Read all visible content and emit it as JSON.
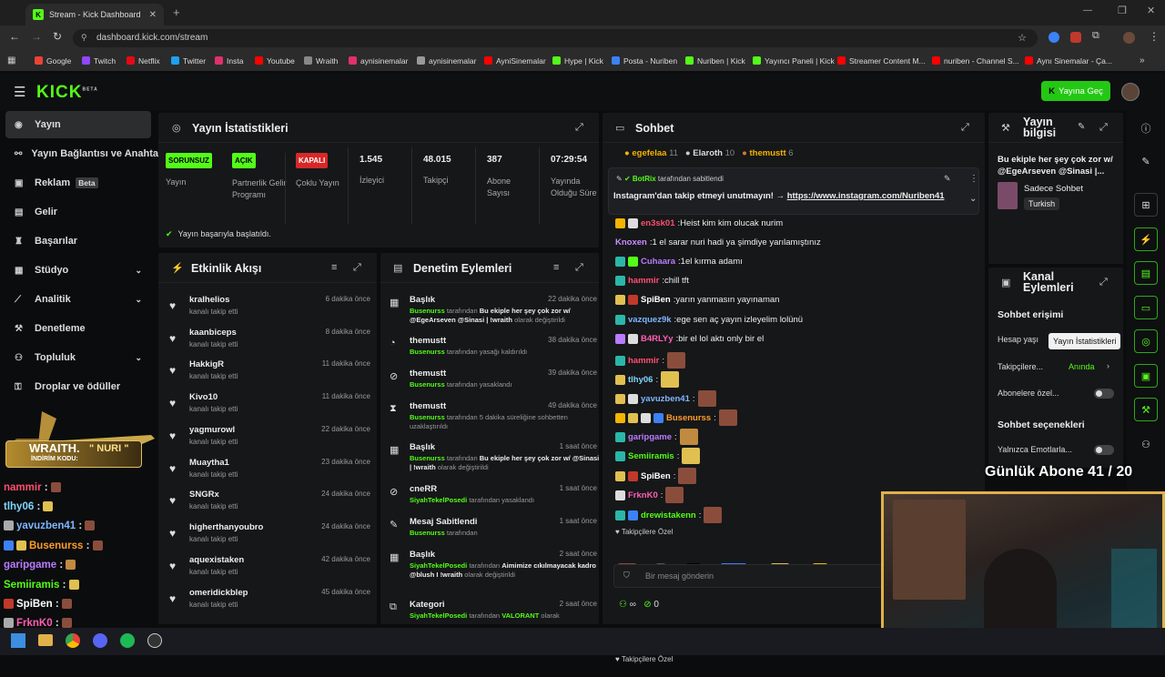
{
  "browser": {
    "tab_title": "Stream - Kick Dashboard",
    "url": "dashboard.kick.com/stream",
    "bookmarks": [
      "Google",
      "Twitch",
      "Netflix",
      "Twitter",
      "Insta",
      "Youtube",
      "Wraith",
      "aynisinemalar",
      "aynisinemalar",
      "AyniSinemalar",
      "Hype | Kick",
      "Posta - Nuriben",
      "Nuriben | Kick",
      "Yayıncı Paneli | Kick",
      "Streamer Content M...",
      "nuriben - Channel S...",
      "Aynı Sinemalar - Ça..."
    ]
  },
  "header": {
    "logo": "KICK",
    "logo_beta": "BETA",
    "go_live": "Yayına Geç"
  },
  "sidebar": {
    "items": [
      {
        "label": "Yayın",
        "icon": "broadcast-icon"
      },
      {
        "label": "Yayın Bağlantısı ve Anahtar",
        "icon": "link-icon"
      },
      {
        "label": "Reklam",
        "icon": "ad-icon",
        "badge": "Beta"
      },
      {
        "label": "Gelir",
        "icon": "money-icon"
      },
      {
        "label": "Başarılar",
        "icon": "trophy-icon"
      },
      {
        "label": "Stüdyo",
        "icon": "studio-icon"
      },
      {
        "label": "Analitik",
        "icon": "analytics-icon"
      },
      {
        "label": "Denetleme",
        "icon": "hammer-icon"
      },
      {
        "label": "Topluluk",
        "icon": "community-icon"
      },
      {
        "label": "Droplar ve ödüller",
        "icon": "gift-icon"
      }
    ]
  },
  "overlay": {
    "wraith_title": "WRAITH.",
    "wraith_code": "\" NURI \"",
    "wraith_sub": "İNDİRİM KODU:",
    "chat": [
      {
        "user": "nammir",
        "color": "#ff4f6e"
      },
      {
        "user": "tlhy06",
        "color": "#7fd6ff"
      },
      {
        "user": "yavuzben41",
        "color": "#7fb6ff"
      },
      {
        "user": "Busenurss",
        "color": "#ff9c2b"
      },
      {
        "user": "garipgame",
        "color": "#b97cff"
      },
      {
        "user": "Semiiramis",
        "color": "#53fc18"
      },
      {
        "user": "SpiBen",
        "color": "#ffffff"
      },
      {
        "user": "FrknK0",
        "color": "#ff5fb3"
      }
    ],
    "sub_goal": "Günlük Abone 41 / 20"
  },
  "stats": {
    "title": "Yayın İstatistikleri",
    "cols": [
      {
        "badge": "SORUNSUZ",
        "label": "Yayın"
      },
      {
        "badge": "AÇIK",
        "label": "Partnerlik Gelir Programı"
      },
      {
        "badge": "KAPALI",
        "label": "Çoklu Yayın"
      },
      {
        "value": "1.545",
        "label": "İzleyici"
      },
      {
        "value": "48.015",
        "label": "Takipçi"
      },
      {
        "value": "387",
        "label": "Abone Sayısı"
      },
      {
        "value": "07:29:54",
        "label": "Yayında Olduğu Süre"
      }
    ],
    "success": "Yayın başarıyla başlatıldı."
  },
  "activity": {
    "title": "Etkinlik Akışı",
    "items": [
      {
        "name": "kralhelios",
        "sub": "kanalı takip etti",
        "time": "6 dakika önce"
      },
      {
        "name": "kaanbiceps",
        "sub": "kanalı takip etti",
        "time": "8 dakika önce"
      },
      {
        "name": "HakkigR",
        "sub": "kanalı takip etti",
        "time": "11 dakika önce"
      },
      {
        "name": "Kivo10",
        "sub": "kanalı takip etti",
        "time": "11 dakika önce"
      },
      {
        "name": "yagmurowl",
        "sub": "kanalı takip etti",
        "time": "22 dakika önce"
      },
      {
        "name": "Muaytha1",
        "sub": "kanalı takip etti",
        "time": "23 dakika önce"
      },
      {
        "name": "SNGRx",
        "sub": "kanalı takip etti",
        "time": "24 dakika önce"
      },
      {
        "name": "higherthanyoubro",
        "sub": "kanalı takip etti",
        "time": "24 dakika önce"
      },
      {
        "name": "aquexistaken",
        "sub": "kanalı takip etti",
        "time": "42 dakika önce"
      },
      {
        "name": "omeridickblep",
        "sub": "kanalı takip etti",
        "time": "45 dakika önce"
      }
    ]
  },
  "moderation": {
    "title": "Denetim Eylemleri",
    "items": [
      {
        "name": "Başlık",
        "time": "22 dakika önce",
        "by": "Busenurss",
        "pre": " tarafından ",
        "bold": "Bu ekiple her şey çok zor w/ @EgeArseven @Sinasi | !wraith",
        "post": " olarak değiştirildi"
      },
      {
        "name": "themustt",
        "time": "38 dakika önce",
        "by": "Busenurss",
        "pre": " tarafından yasağı kaldırıldı",
        "bold": "",
        "post": ""
      },
      {
        "name": "themustt",
        "time": "39 dakika önce",
        "by": "Busenurss",
        "pre": " tarafından yasaklandı",
        "bold": "",
        "post": ""
      },
      {
        "name": "themustt",
        "time": "49 dakika önce",
        "by": "Busenurss",
        "pre": " tarafından 5 dakika süreliğine sohbetten uzaklaştırıldı",
        "bold": "",
        "post": ""
      },
      {
        "name": "Başlık",
        "time": "1 saat önce",
        "by": "Busenurss",
        "pre": " tarafından ",
        "bold": "Bu ekiple her şey çok zor w/ @Sinasi | !wraith",
        "post": " olarak değiştirildi"
      },
      {
        "name": "cneRR",
        "time": "1 saat önce",
        "by": "SiyahTekelPosedi",
        "pre": " tarafından yasaklandı",
        "bold": "",
        "post": ""
      },
      {
        "name": "Mesaj Sabitlendi",
        "time": "1 saat önce",
        "by": "Busenurss",
        "pre": " tarafından",
        "bold": "",
        "post": ""
      },
      {
        "name": "Başlık",
        "time": "2 saat önce",
        "by": "SiyahTekelPosedi",
        "pre": " tarafından ",
        "bold": "Aimimize cıkılmayacak kadro @blush I !wraith",
        "post": " olarak değiştirildi"
      },
      {
        "name": "Kategori",
        "time": "2 saat önce",
        "by": "SiyahTekelPosedi",
        "pre": " tarafından ",
        "bold": "VALORANT",
        "post": " olarak"
      }
    ]
  },
  "chat": {
    "title": "Sohbet",
    "top": [
      {
        "name": "egefelaa",
        "n": "11"
      },
      {
        "name": "Elaroth",
        "n": "10"
      },
      {
        "name": "themustt",
        "n": "6"
      }
    ],
    "pinned_by": "BotRix",
    "pinned_label": " tarafından sabitlendi",
    "pinned_text": "Instagram'dan takip etmeyi unutmayın! → ",
    "pinned_link": "https://www.instagram.com/Nuriben41",
    "messages": [
      {
        "user": "en3sk01",
        "color": "#ff4f6e",
        "text": "Heist kim kim olucak nurim"
      },
      {
        "user": "Knoxen",
        "color": "#c98cff",
        "text": "1 el sarar nuri hadi ya şimdiye yarılamıştınız"
      },
      {
        "user": "Cuhaara",
        "color": "#b97cff",
        "text": "1el kırma adamı"
      },
      {
        "user": "hammir",
        "color": "#ff4f6e",
        "text": "chill tft"
      },
      {
        "user": "SpiBen",
        "color": "#ffffff",
        "text": "yarın yanmasın yayınaman"
      },
      {
        "user": "vazquez9k",
        "color": "#7fb6ff",
        "text": "ege sen aç yayın izleyelim lolünü"
      },
      {
        "user": "B4RLYy",
        "color": "#ff5fb3",
        "text": "bir el lol aktı only bir el"
      },
      {
        "user": "hammir",
        "color": "#ff4f6e",
        "text": ""
      },
      {
        "user": "tlhy06",
        "color": "#7fd6ff",
        "text": ""
      },
      {
        "user": "yavuzben41",
        "color": "#7fb6ff",
        "text": ""
      },
      {
        "user": "Busenurss",
        "color": "#ff9c2b",
        "text": ""
      },
      {
        "user": "garipgame",
        "color": "#b97cff",
        "text": ""
      },
      {
        "user": "Semiiramis",
        "color": "#53fc18",
        "text": ""
      },
      {
        "user": "SpiBen",
        "color": "#ffffff",
        "text": ""
      },
      {
        "user": "FrknK0",
        "color": "#ff5fb3",
        "text": ""
      },
      {
        "user": "drewistakenn",
        "color": "#53fc18",
        "text": ""
      }
    ],
    "sub_emotes_label": "Takipçilere Özel",
    "input_placeholder": "Bir mesaj gönderin",
    "count_a": "0"
  },
  "info": {
    "title": "Yayın bilgisi",
    "stream_title": "Bu ekiple her şey çok zor w/ @EgeArseven @Sinasi |...",
    "category": "Sadece Sohbet",
    "language": "Turkish"
  },
  "channel": {
    "title": "Kanal Eylemleri",
    "section1": "Sohbet erişimi",
    "row1": "Hesap yaşı",
    "row2": "Takipçilere...",
    "row2_value": "Anında",
    "row3": "Abonelere özel...",
    "section2": "Sohbet seçenekleri",
    "row4": "Yalnızca Emotlarla...",
    "tooltip": "Yayın İstatistikleri"
  }
}
